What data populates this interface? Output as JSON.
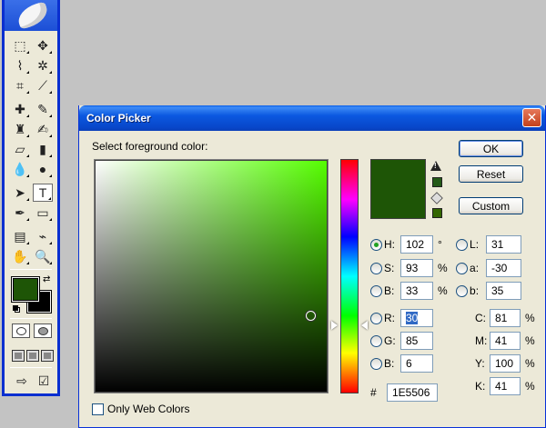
{
  "toolbox": {
    "tools": [
      {
        "name": "marquee-tool",
        "icon": "marquee-icon",
        "glyph": "⬚"
      },
      {
        "name": "move-tool",
        "icon": "move-icon",
        "glyph": "✥"
      },
      {
        "name": "lasso-tool",
        "icon": "lasso-icon",
        "glyph": "⌇"
      },
      {
        "name": "magic-wand-tool",
        "icon": "magic-wand-icon",
        "glyph": "✲"
      },
      {
        "name": "crop-tool",
        "icon": "crop-icon",
        "glyph": "⌗"
      },
      {
        "name": "slice-tool",
        "icon": "slice-icon",
        "glyph": "⟋"
      },
      {
        "name": "healing-brush-tool",
        "icon": "bandage-icon",
        "glyph": "✚"
      },
      {
        "name": "brush-tool",
        "icon": "brush-icon",
        "glyph": "✎"
      },
      {
        "name": "clone-stamp-tool",
        "icon": "stamp-icon",
        "glyph": "♜"
      },
      {
        "name": "history-brush-tool",
        "icon": "history-brush-icon",
        "glyph": "✍"
      },
      {
        "name": "eraser-tool",
        "icon": "eraser-icon",
        "glyph": "▱"
      },
      {
        "name": "gradient-tool",
        "icon": "gradient-icon",
        "glyph": "▮"
      },
      {
        "name": "blur-tool",
        "icon": "blur-drop-icon",
        "glyph": "💧"
      },
      {
        "name": "dodge-tool",
        "icon": "dodge-icon",
        "glyph": "●"
      },
      {
        "name": "path-selection-tool",
        "icon": "arrow-icon",
        "glyph": "➤"
      },
      {
        "name": "type-tool",
        "icon": "type-icon",
        "glyph": "T",
        "selected": true
      },
      {
        "name": "pen-tool",
        "icon": "pen-icon",
        "glyph": "✒"
      },
      {
        "name": "shape-tool",
        "icon": "rectangle-shape-icon",
        "glyph": "▭"
      },
      {
        "name": "notes-tool",
        "icon": "notes-icon",
        "glyph": "▤"
      },
      {
        "name": "eyedropper-tool",
        "icon": "eyedropper-icon",
        "glyph": "⌁"
      },
      {
        "name": "hand-tool",
        "icon": "hand-icon",
        "glyph": "✋"
      },
      {
        "name": "zoom-tool",
        "icon": "zoom-icon",
        "glyph": "🔍"
      }
    ],
    "foreground_color": "#1e5506",
    "background_color": "#000000"
  },
  "dialog": {
    "title": "Color Picker",
    "prompt": "Select foreground color:",
    "buttons": {
      "ok": "OK",
      "reset": "Reset",
      "custom": "Custom"
    },
    "preview_color": "#1e5506",
    "hsb": [
      {
        "key": "H",
        "value": "102",
        "unit": "°",
        "checked": true
      },
      {
        "key": "S",
        "value": "93",
        "unit": "%"
      },
      {
        "key": "B",
        "value": "33",
        "unit": "%"
      }
    ],
    "rgb": [
      {
        "key": "R",
        "value": "30",
        "selected": true
      },
      {
        "key": "G",
        "value": "85"
      },
      {
        "key": "B",
        "value": "6"
      }
    ],
    "lab": [
      {
        "key": "L",
        "value": "31"
      },
      {
        "key": "a",
        "value": "-30"
      },
      {
        "key": "b",
        "value": "35"
      }
    ],
    "cmyk": [
      {
        "key": "C",
        "value": "81",
        "unit": "%"
      },
      {
        "key": "M",
        "value": "41",
        "unit": "%"
      },
      {
        "key": "Y",
        "value": "100",
        "unit": "%"
      },
      {
        "key": "K",
        "value": "41",
        "unit": "%"
      }
    ],
    "hex_label": "#",
    "hex_value": "1E5506",
    "web_colors_label": "Only Web Colors"
  }
}
